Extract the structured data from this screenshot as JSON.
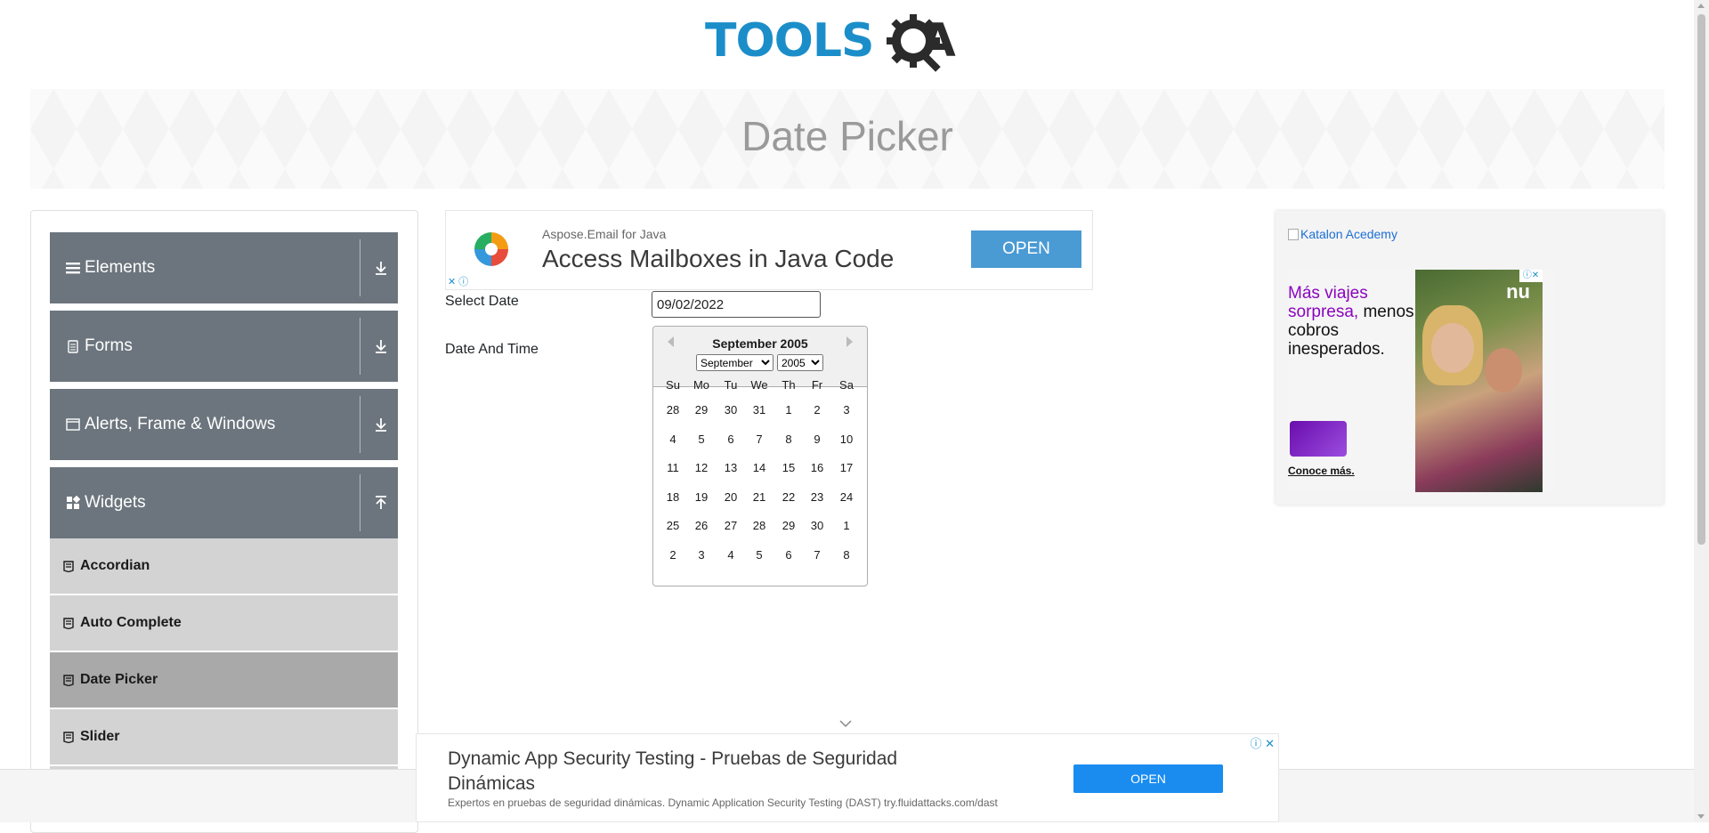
{
  "logo": {
    "text_main": "TOOLS",
    "text_q": "Q",
    "text_a": "A"
  },
  "banner": {
    "title": "Date Picker"
  },
  "sidebar": {
    "groups": [
      {
        "label": "Elements",
        "icon": "hamburger-icon"
      },
      {
        "label": "Forms",
        "icon": "document-icon"
      },
      {
        "label": "Alerts, Frame & Windows",
        "icon": "window-icon"
      },
      {
        "label": "Widgets",
        "icon": "widgets-grid-icon"
      }
    ],
    "items": [
      {
        "label": "Accordian"
      },
      {
        "label": "Auto Complete"
      },
      {
        "label": "Date Picker",
        "active": true
      },
      {
        "label": "Slider"
      }
    ]
  },
  "ad_top": {
    "sub": "Aspose.Email for Java",
    "headline": "Access Mailboxes in Java Code",
    "button": "OPEN"
  },
  "form": {
    "select_date_label": "Select Date",
    "select_date_value": "09/02/2022",
    "date_time_label": "Date And Time"
  },
  "calendar": {
    "current_month": "September 2005",
    "month_select": "September",
    "year_select": "2005",
    "day_names": [
      "Su",
      "Mo",
      "Tu",
      "We",
      "Th",
      "Fr",
      "Sa"
    ],
    "weeks": [
      [
        "28",
        "29",
        "30",
        "31",
        "1",
        "2",
        "3"
      ],
      [
        "4",
        "5",
        "6",
        "7",
        "8",
        "9",
        "10"
      ],
      [
        "11",
        "12",
        "13",
        "14",
        "15",
        "16",
        "17"
      ],
      [
        "18",
        "19",
        "20",
        "21",
        "22",
        "23",
        "24"
      ],
      [
        "25",
        "26",
        "27",
        "28",
        "29",
        "30",
        "1"
      ],
      [
        "2",
        "3",
        "4",
        "5",
        "6",
        "7",
        "8"
      ]
    ]
  },
  "ad_right": {
    "broken_image_alt": "Katalon Acedemy",
    "nu_headline_1": "Más viajes sorpresa,",
    "nu_headline_2": "menos cobros inesperados.",
    "nu_link": "Conoce más.",
    "nu_logo": "nu"
  },
  "ad_bottom": {
    "headline": "Dynamic App Security Testing - Pruebas de Seguridad Dinámicas",
    "description": "Expertos en pruebas de seguridad dinámicas. Dynamic Application Security Testing (DAST) try.fluidattacks.com/dast",
    "button": "OPEN"
  },
  "colors": {
    "brand_blue": "#1b8ec9",
    "sidebar_header": "#6c757d",
    "menu_item": "#d3d3d3",
    "menu_item_active": "#a9a9a9"
  }
}
